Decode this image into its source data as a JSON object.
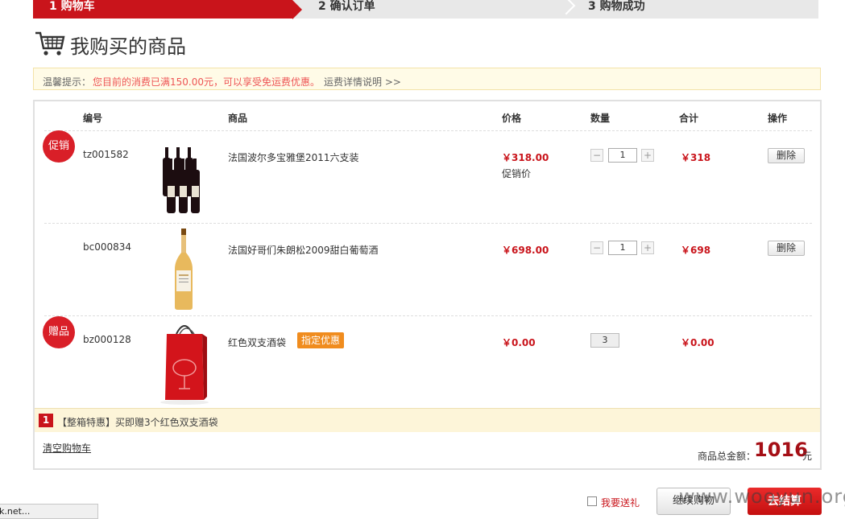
{
  "steps": [
    {
      "label": "1  购物车",
      "active": true
    },
    {
      "label": "2  确认订单",
      "active": false
    },
    {
      "label": "3  购物成功",
      "active": false
    }
  ],
  "page_title": "我购买的商品",
  "tip": {
    "label": "温馨提示：",
    "text": "您目前的消费已满150.00元，可以享受免运费优惠。",
    "link": "运费详情说明 >>"
  },
  "table_headers": {
    "code": "编号",
    "product": "商品",
    "price": "价格",
    "quantity": "数量",
    "subtotal": "合计",
    "action": "操作"
  },
  "items": [
    {
      "badge": "促销",
      "code": "tz001582",
      "name": "法国波尔多宝雅堡2011六支装",
      "price": "￥318.00",
      "price_note": "促销价",
      "qty": "1",
      "minus": "−",
      "plus": "+",
      "subtotal": "￥318",
      "delete": "删除"
    },
    {
      "code": "bc000834",
      "name": "法国好哥们朱朗松2009甜白葡萄酒",
      "price": "￥698.00",
      "qty": "1",
      "minus": "−",
      "plus": "+",
      "subtotal": "￥698",
      "delete": "删除"
    },
    {
      "badge": "赠品",
      "code": "bz000128",
      "name": "红色双支酒袋",
      "tag": "指定优惠",
      "price": "￥0.00",
      "qty": "3",
      "subtotal": "￥0.00"
    }
  ],
  "promo": {
    "number": "1",
    "text": "【整箱特惠】买即赠3个红色双支酒袋"
  },
  "clear_cart": "清空购物车",
  "total": {
    "label": "商品总金额：",
    "value": "1016",
    "unit": "元"
  },
  "gift_label": "我要送礼",
  "continue_button": "继续购物",
  "checkout_button": "去结算",
  "watermark": "www.wooyun.org",
  "status_text": "k.net...",
  "colors": {
    "brand_red": "#c9141b",
    "promo_orange": "#f08c1e",
    "tip_bg": "#fffbe7"
  }
}
